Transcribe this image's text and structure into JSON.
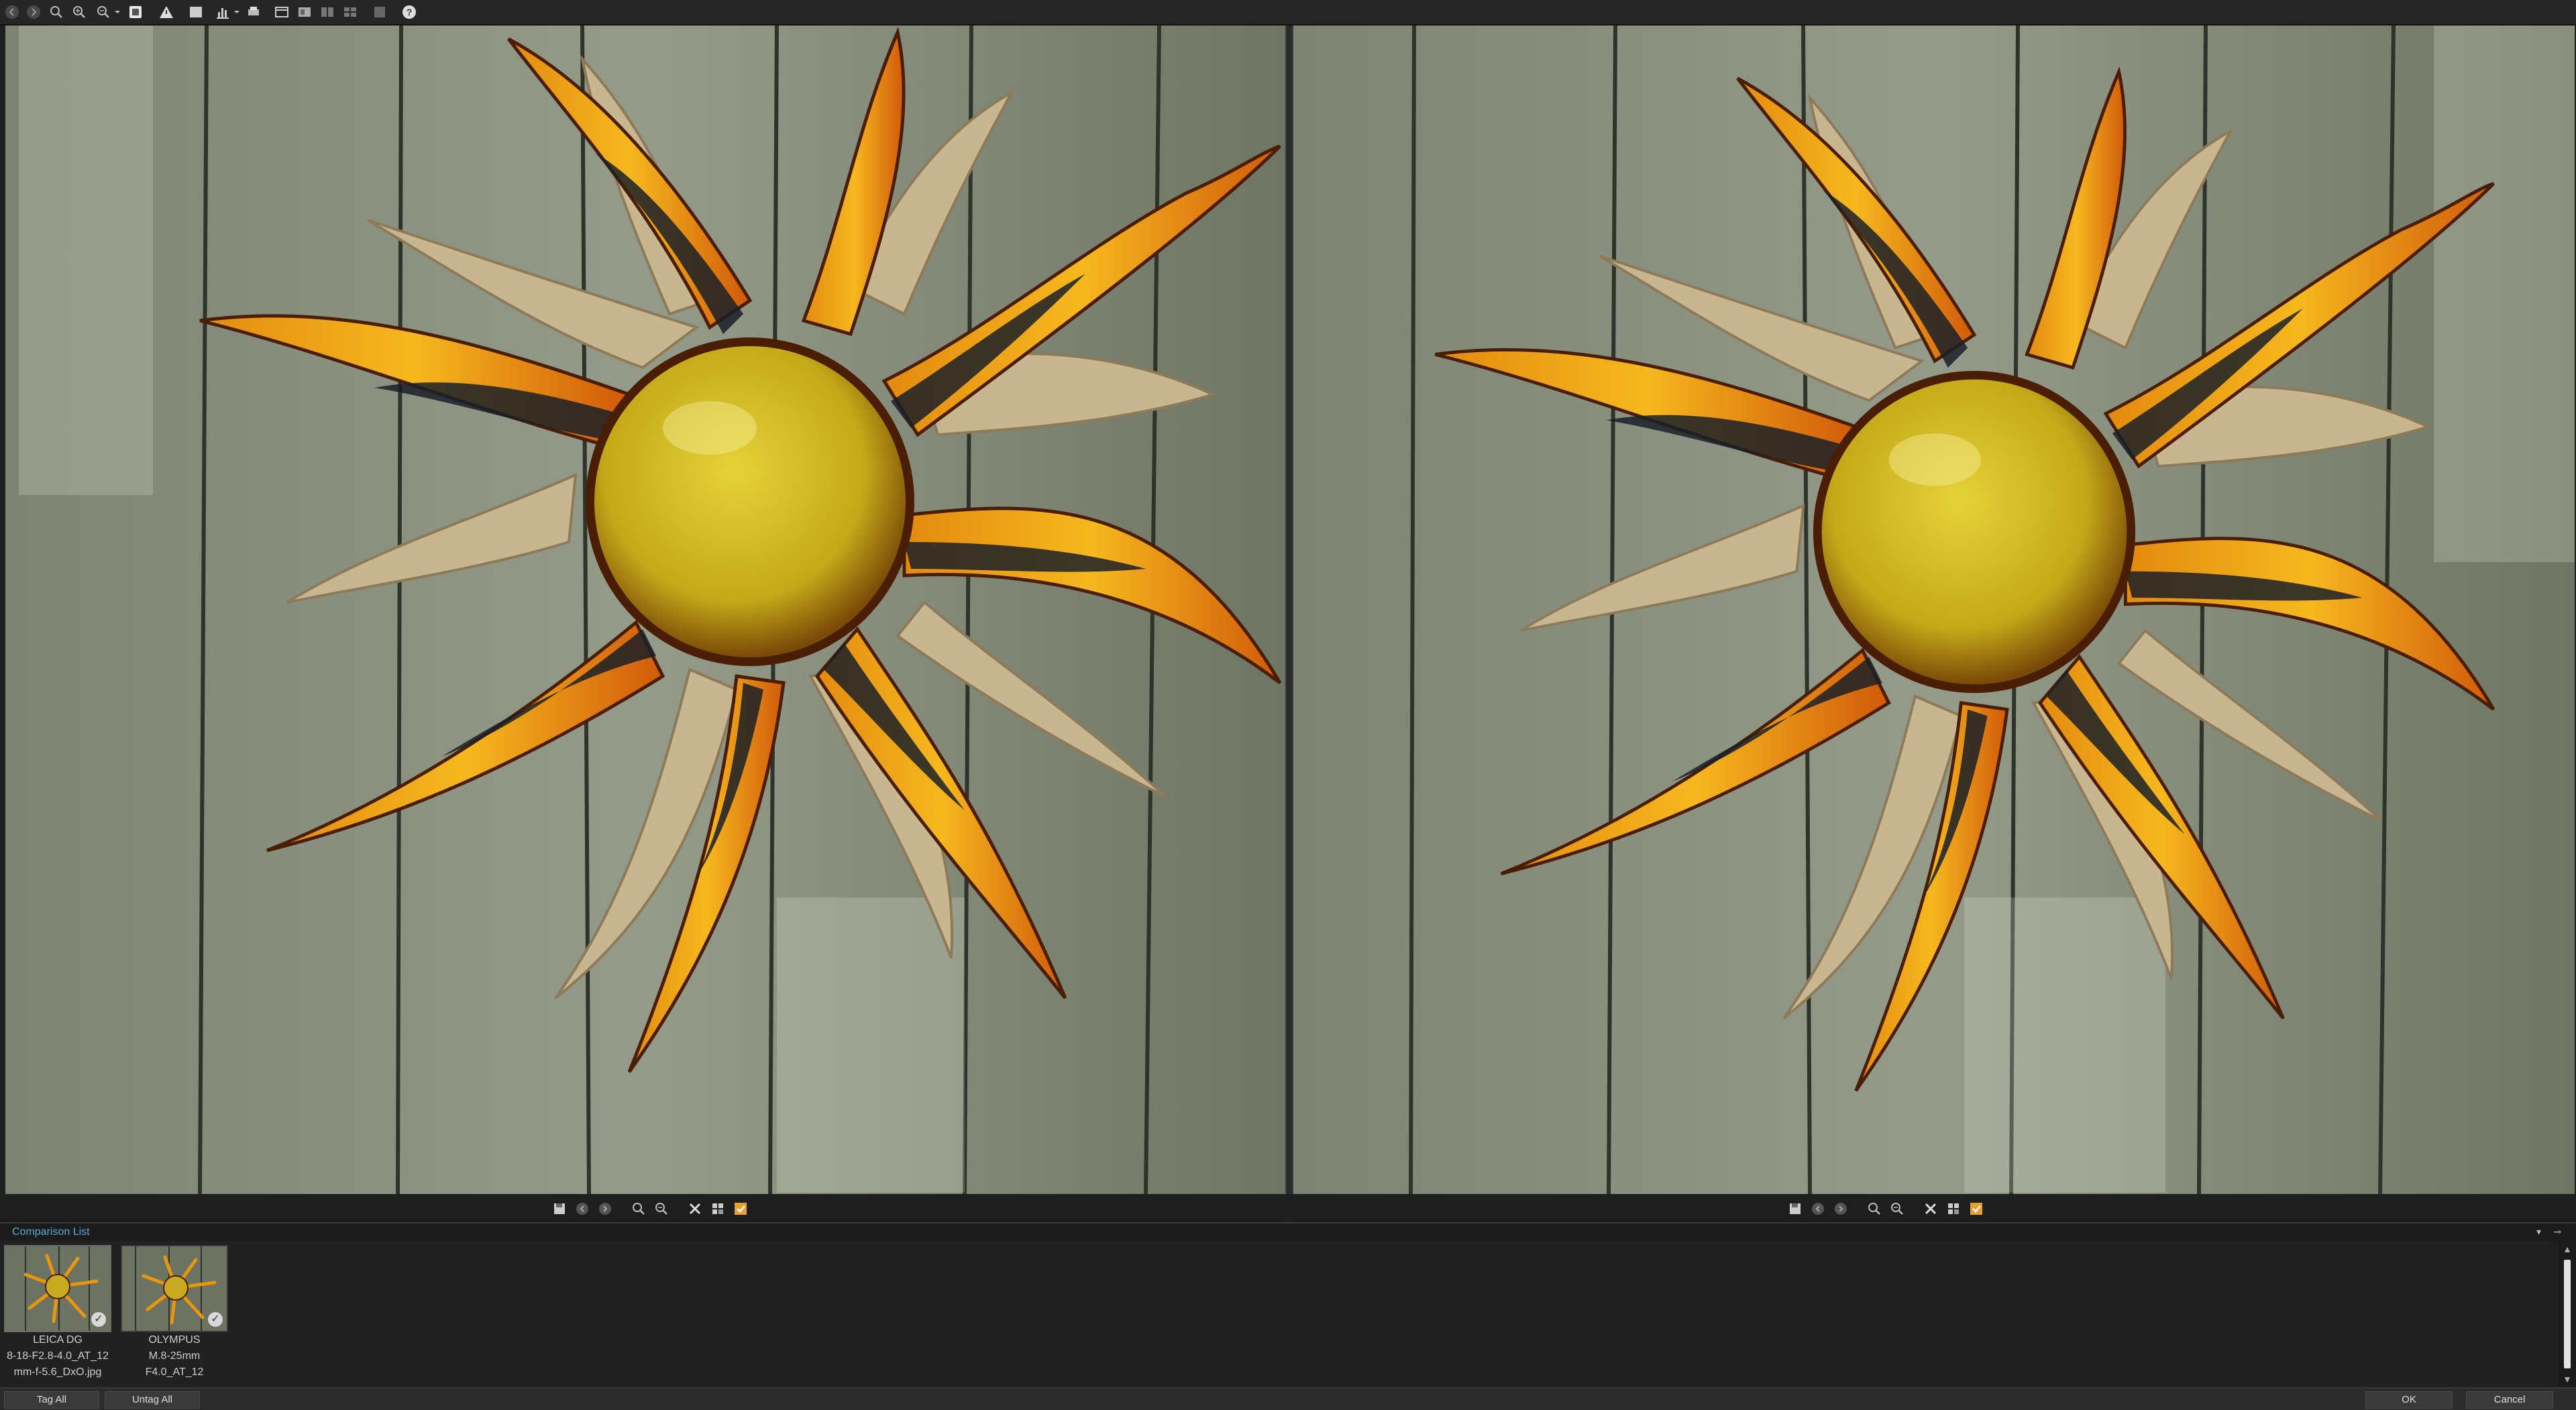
{
  "comparison_list": {
    "title": "Comparison List",
    "items": [
      {
        "line1": "LEICA DG",
        "line2": "8-18-F2.8-4.0_AT_12",
        "line3": "mm-f-5.6_DxO.jpg"
      },
      {
        "line1": "OLYMPUS",
        "line2": "M.8-25mm",
        "line3": "F4.0_AT_12"
      }
    ]
  },
  "footer": {
    "tag_all": "Tag All",
    "untag_all": "Untag All",
    "ok": "OK",
    "cancel": "Cancel"
  },
  "toolbar_icons": [
    "back-icon",
    "forward-icon",
    "zoom-fit-icon",
    "zoom-in-icon",
    "zoom-out-icon",
    "copy-icon",
    "warning-icon",
    "frame-icon",
    "histogram-icon",
    "window-icon",
    "layout-icon",
    "help-icon"
  ],
  "colors": {
    "accent": "#5aa8d8",
    "toolbar_bg": "#262626",
    "panel_bg": "#212121"
  }
}
